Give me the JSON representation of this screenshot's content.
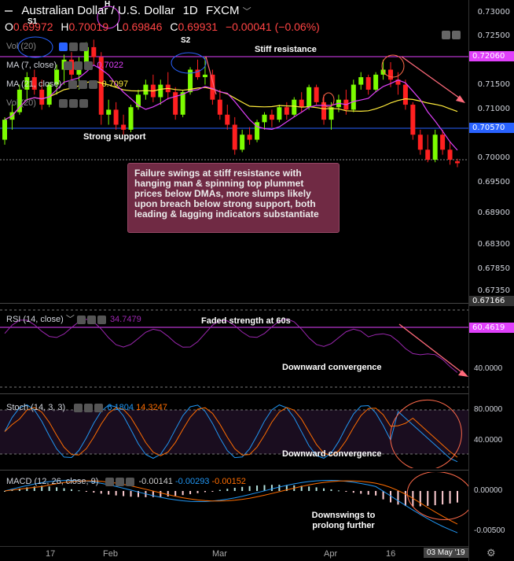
{
  "header": {
    "symbol": "Australian Dollar / U.S. Dollar",
    "interval": "1D",
    "exchange": "FXCM",
    "open_label": "O",
    "open": "0.69972",
    "high_label": "H",
    "high": "0.70019",
    "low_label": "L",
    "low": "0.69846",
    "close_label": "C",
    "close": "0.69931",
    "change": "−0.00041 (−0.06%)"
  },
  "legends": {
    "vol": "Vol (20)",
    "ma7": "MA (7, close)",
    "ma7_value": "0.7022",
    "ma21": "MA (21, close)",
    "ma21_value": "0.7097",
    "vol2": "Vol (20)"
  },
  "price_axis": [
    "0.73000",
    "0.72500",
    "0.72060",
    "0.71500",
    "0.71000",
    "0.70570",
    "0.70000",
    "0.69500",
    "0.68900",
    "0.68300",
    "0.67850",
    "0.67350",
    "0.67166"
  ],
  "price_tags": {
    "resistance": "0.72060",
    "support": "0.70570",
    "last": "0.67166"
  },
  "annotations": {
    "stiff_resistance": "Stiff resistance",
    "strong_support": "Strong support",
    "s1": "S1",
    "s2": "S2",
    "h": "H",
    "callout": "Failure swings at stiff resistance with hanging man & spinning top plummet prices below DMAs, more slumps likely upon breach below strong support, both leading & lagging indicators substantiate",
    "faded_strength": "Faded strength at 60s",
    "downward_convergence_rsi": "Downward convergence",
    "downward_convergence_stoch": "Downward convergence",
    "downswings": "Downswings to prolong further"
  },
  "rsi": {
    "title": "RSI (14, close)",
    "value": "34.7479",
    "tag": "60.4619",
    "axis": "40.0000"
  },
  "stoch": {
    "title": "Stoch (14, 3, 3)",
    "k": "6.1804",
    "d": "14.3247",
    "axis_hi": "80.0000",
    "axis_lo": "40.0000"
  },
  "macd": {
    "title": "MACD (12, 26, close, 9)",
    "v1": "-0.00141",
    "v2": "-0.00293",
    "v3": "-0.00152",
    "axis_hi": "0.00000",
    "axis_lo": "-0.00500"
  },
  "time_axis": {
    "labels": [
      "17",
      "Feb",
      "Mar",
      "Apr",
      "16"
    ],
    "current": "03 May '19"
  },
  "colors": {
    "bull": "#53b987",
    "bear": "#eb4d5c",
    "ma7": "#e040fb",
    "ma21": "#ffeb3b",
    "resistance": "#e040fb",
    "support": "#2962ff",
    "green_candle": "#7cfc00",
    "red_candle": "#ff2020"
  },
  "candles": [
    [
      0.704,
      0.7085,
      0.703,
      0.708
    ],
    [
      0.708,
      0.711,
      0.706,
      0.7095
    ],
    [
      0.7095,
      0.715,
      0.709,
      0.714
    ],
    [
      0.714,
      0.7175,
      0.712,
      0.7165
    ],
    [
      0.7165,
      0.718,
      0.713,
      0.714
    ],
    [
      0.714,
      0.716,
      0.71,
      0.711
    ],
    [
      0.711,
      0.7155,
      0.7105,
      0.715
    ],
    [
      0.715,
      0.719,
      0.713,
      0.718
    ],
    [
      0.718,
      0.721,
      0.715,
      0.72
    ],
    [
      0.72,
      0.7215,
      0.716,
      0.717
    ],
    [
      0.717,
      0.7205,
      0.714,
      0.7195
    ],
    [
      0.7195,
      0.7235,
      0.718,
      0.7225
    ],
    [
      0.7225,
      0.724,
      0.719,
      0.7205
    ],
    [
      0.7205,
      0.7215,
      0.707,
      0.709
    ],
    [
      0.709,
      0.712,
      0.707,
      0.71
    ],
    [
      0.71,
      0.7115,
      0.706,
      0.707
    ],
    [
      0.707,
      0.709,
      0.705,
      0.706
    ],
    [
      0.706,
      0.711,
      0.7055,
      0.7105
    ],
    [
      0.7105,
      0.714,
      0.71,
      0.713
    ],
    [
      0.713,
      0.716,
      0.712,
      0.715
    ],
    [
      0.715,
      0.717,
      0.7115,
      0.7125
    ],
    [
      0.7125,
      0.716,
      0.711,
      0.715
    ],
    [
      0.715,
      0.7175,
      0.712,
      0.7135
    ],
    [
      0.7135,
      0.7145,
      0.708,
      0.709
    ],
    [
      0.709,
      0.714,
      0.7085,
      0.7135
    ],
    [
      0.7135,
      0.7185,
      0.713,
      0.718
    ],
    [
      0.718,
      0.72,
      0.716,
      0.7165
    ],
    [
      0.7165,
      0.7205,
      0.715,
      0.717
    ],
    [
      0.717,
      0.718,
      0.711,
      0.712
    ],
    [
      0.712,
      0.714,
      0.708,
      0.709
    ],
    [
      0.709,
      0.711,
      0.706,
      0.707
    ],
    [
      0.707,
      0.7085,
      0.701,
      0.702
    ],
    [
      0.702,
      0.706,
      0.7015,
      0.705
    ],
    [
      0.705,
      0.7065,
      0.703,
      0.704
    ],
    [
      0.704,
      0.708,
      0.7035,
      0.7075
    ],
    [
      0.7075,
      0.7095,
      0.706,
      0.709
    ],
    [
      0.709,
      0.71,
      0.7065,
      0.708
    ],
    [
      0.708,
      0.711,
      0.7075,
      0.7105
    ],
    [
      0.7105,
      0.7115,
      0.708,
      0.709
    ],
    [
      0.709,
      0.7125,
      0.7085,
      0.712
    ],
    [
      0.712,
      0.7135,
      0.7095,
      0.7105
    ],
    [
      0.7105,
      0.715,
      0.71,
      0.7145
    ],
    [
      0.7145,
      0.715,
      0.711,
      0.7115
    ],
    [
      0.7115,
      0.713,
      0.707,
      0.708
    ],
    [
      0.708,
      0.7115,
      0.706,
      0.7105
    ],
    [
      0.7105,
      0.713,
      0.7095,
      0.712
    ],
    [
      0.712,
      0.714,
      0.709,
      0.71
    ],
    [
      0.71,
      0.716,
      0.7095,
      0.715
    ],
    [
      0.715,
      0.7175,
      0.714,
      0.7165
    ],
    [
      0.7165,
      0.717,
      0.713,
      0.714
    ],
    [
      0.714,
      0.7175,
      0.7135,
      0.717
    ],
    [
      0.717,
      0.72,
      0.716,
      0.718
    ],
    [
      0.718,
      0.7195,
      0.7145,
      0.716
    ],
    [
      0.716,
      0.7175,
      0.713,
      0.715
    ],
    [
      0.715,
      0.716,
      0.71,
      0.711
    ],
    [
      0.711,
      0.7115,
      0.704,
      0.705
    ],
    [
      0.705,
      0.706,
      0.701,
      0.702
    ],
    [
      0.702,
      0.705,
      0.6995,
      0.7
    ],
    [
      0.7,
      0.706,
      0.6995,
      0.705
    ],
    [
      0.705,
      0.706,
      0.701,
      0.702
    ],
    [
      0.702,
      0.7035,
      0.699,
      0.7
    ],
    [
      0.6997,
      0.7002,
      0.6985,
      0.6993
    ]
  ]
}
